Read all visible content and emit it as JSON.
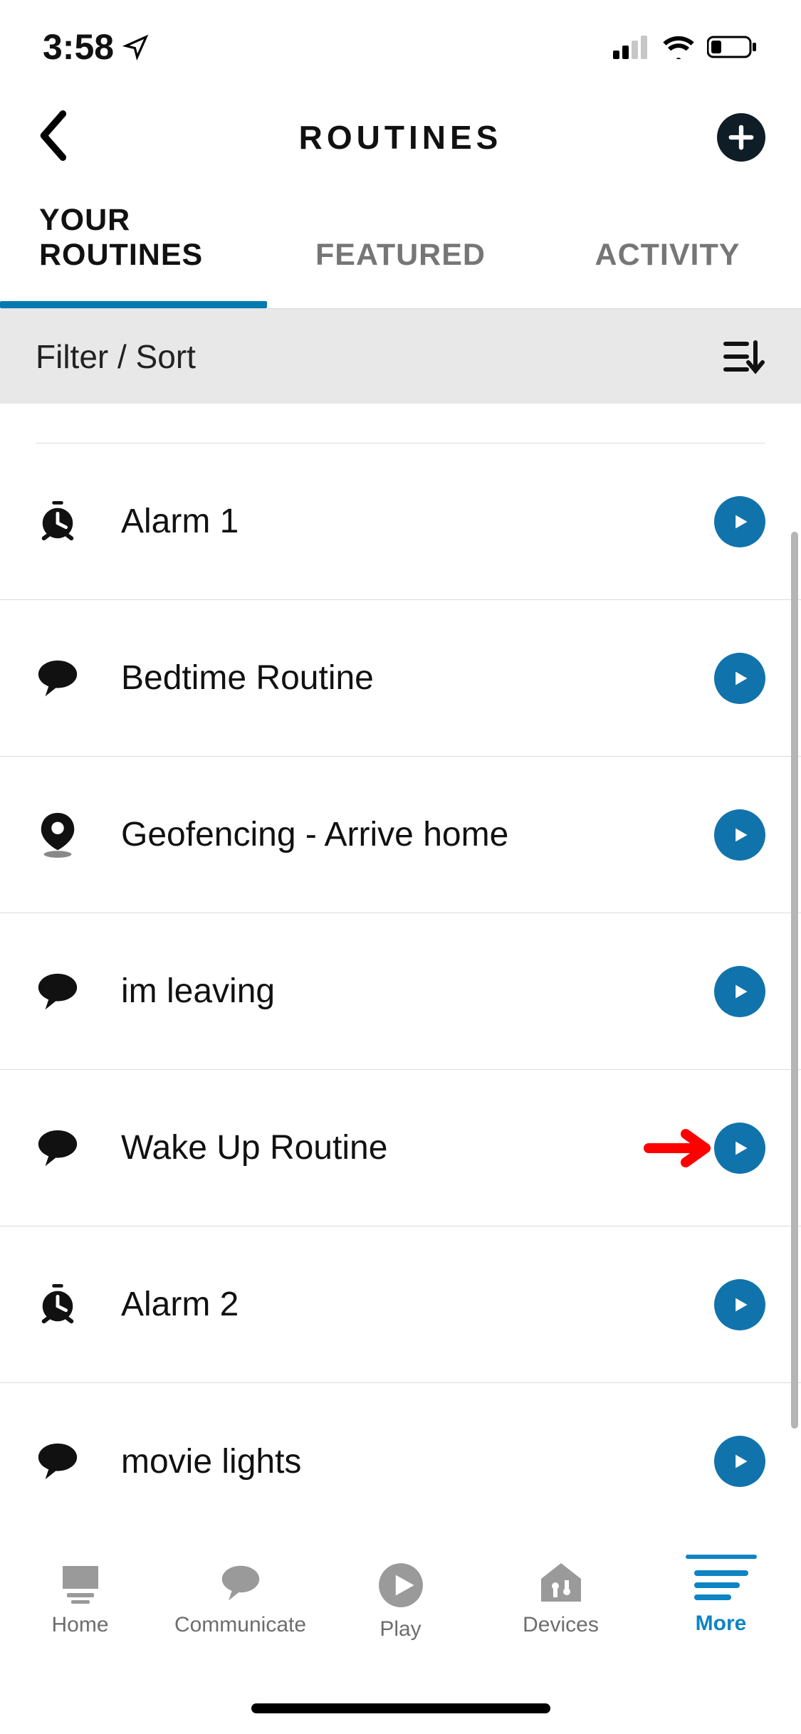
{
  "status": {
    "time": "3:58"
  },
  "header": {
    "title": "ROUTINES"
  },
  "tabs": {
    "items": [
      {
        "label": "YOUR ROUTINES",
        "active": true
      },
      {
        "label": "FEATURED",
        "active": false
      },
      {
        "label": "ACTIVITY",
        "active": false
      }
    ]
  },
  "filter": {
    "label": "Filter / Sort"
  },
  "routines": [
    {
      "icon": "alarm",
      "label": "Alarm 1"
    },
    {
      "icon": "speech",
      "label": "Bedtime Routine"
    },
    {
      "icon": "location",
      "label": "Geofencing - Arrive home"
    },
    {
      "icon": "speech",
      "label": "im leaving"
    },
    {
      "icon": "speech",
      "label": "Wake Up Routine"
    },
    {
      "icon": "alarm",
      "label": "Alarm 2"
    },
    {
      "icon": "speech",
      "label": "movie lights"
    }
  ],
  "annotation": {
    "target_index": 4
  },
  "nav": {
    "items": [
      {
        "label": "Home"
      },
      {
        "label": "Communicate"
      },
      {
        "label": "Play"
      },
      {
        "label": "Devices"
      },
      {
        "label": "More"
      }
    ],
    "active_index": 4
  },
  "colors": {
    "accent": "#1173ac",
    "accent_blue": "#0d84c3",
    "annotation_red": "#ff0000"
  }
}
